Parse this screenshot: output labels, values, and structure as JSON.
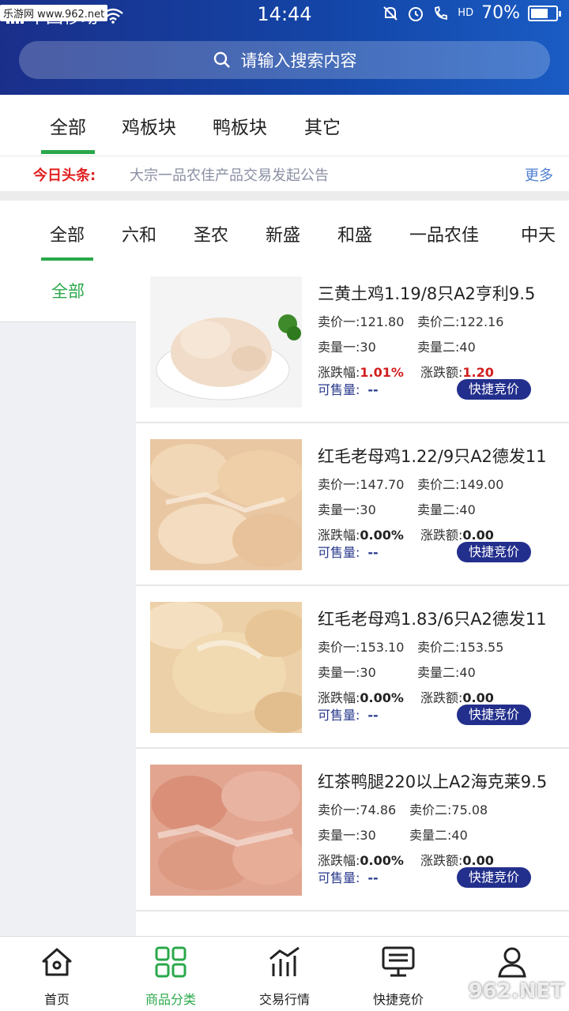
{
  "status_bar": {
    "watermark": "乐游网 www.962.net",
    "carrier": "中国移动",
    "time": "14:44",
    "network": "HD",
    "battery_percent": "70%",
    "battery_level": 0.7
  },
  "search": {
    "placeholder": "请输入搜索内容",
    "icon": "search-icon"
  },
  "category_tabs": [
    {
      "label": "全部",
      "active": true
    },
    {
      "label": "鸡板块",
      "active": false
    },
    {
      "label": "鸭板块",
      "active": false
    },
    {
      "label": "其它",
      "active": false
    }
  ],
  "news": {
    "label": "今日头条:",
    "text": "大宗一品农佳产品交易发起公告",
    "more": "更多"
  },
  "brand_tabs": [
    {
      "label": "全部",
      "active": true
    },
    {
      "label": "六和"
    },
    {
      "label": "圣农"
    },
    {
      "label": "新盛"
    },
    {
      "label": "和盛"
    },
    {
      "label": "一品农佳"
    },
    {
      "label": "中天"
    }
  ],
  "left_menu": {
    "selected": "全部"
  },
  "products": [
    {
      "name": "三黄土鸡1.19/8只A2亨利9.5",
      "price1_label": "卖价一:",
      "price1": "121.80",
      "price2_label": "卖价二:",
      "price2": "122.16",
      "qty1_label": "卖量一:",
      "qty1": "30",
      "qty2_label": "卖量二:",
      "qty2": "40",
      "change_pct_label": "涨跌幅:",
      "change_pct": "1.01%",
      "change_amt_label": "涨跌额:",
      "change_amt": "1.20",
      "stock_label": "可售量:",
      "stock": "--",
      "button": "快捷竞价",
      "trend": "up"
    },
    {
      "name": "红毛老母鸡1.22/9只A2德发11",
      "price1_label": "卖价一:",
      "price1": "147.70",
      "price2_label": "卖价二:",
      "price2": "149.00",
      "qty1_label": "卖量一:",
      "qty1": "30",
      "qty2_label": "卖量二:",
      "qty2": "40",
      "change_pct_label": "涨跌幅:",
      "change_pct": "0.00%",
      "change_amt_label": "涨跌额:",
      "change_amt": "0.00",
      "stock_label": "可售量:",
      "stock": "--",
      "button": "快捷竞价",
      "trend": "flat"
    },
    {
      "name": "红毛老母鸡1.83/6只A2德发11",
      "price1_label": "卖价一:",
      "price1": "153.10",
      "price2_label": "卖价二:",
      "price2": "153.55",
      "qty1_label": "卖量一:",
      "qty1": "30",
      "qty2_label": "卖量二:",
      "qty2": "40",
      "change_pct_label": "涨跌幅:",
      "change_pct": "0.00%",
      "change_amt_label": "涨跌额:",
      "change_amt": "0.00",
      "stock_label": "可售量:",
      "stock": "--",
      "button": "快捷竞价",
      "trend": "flat"
    },
    {
      "name": "红茶鸭腿220以上A2海克莱9.5",
      "price1_label": "卖价一:",
      "price1": "74.86",
      "price2_label": "卖价二:",
      "price2": "75.08",
      "qty1_label": "卖量一:",
      "qty1": "30",
      "qty2_label": "卖量二:",
      "qty2": "40",
      "change_pct_label": "涨跌幅:",
      "change_pct": "0.00%",
      "change_amt_label": "涨跌额:",
      "change_amt": "0.00",
      "stock_label": "可售量:",
      "stock": "--",
      "button": "快捷竞价",
      "trend": "flat"
    }
  ],
  "bottom_nav": [
    {
      "label": "首页",
      "icon": "home-icon",
      "active": false
    },
    {
      "label": "商品分类",
      "icon": "grid-icon",
      "active": true
    },
    {
      "label": "交易行情",
      "icon": "chart-icon",
      "active": false
    },
    {
      "label": "快捷竞价",
      "icon": "monitor-icon",
      "active": false
    },
    {
      "label": "",
      "icon": "user-icon",
      "active": false
    }
  ],
  "watermark_corner": "962.NET",
  "colors": {
    "accent": "#2aa84a",
    "header": "#1346a8",
    "button": "#232f8c",
    "rise": "#d21f1f"
  }
}
